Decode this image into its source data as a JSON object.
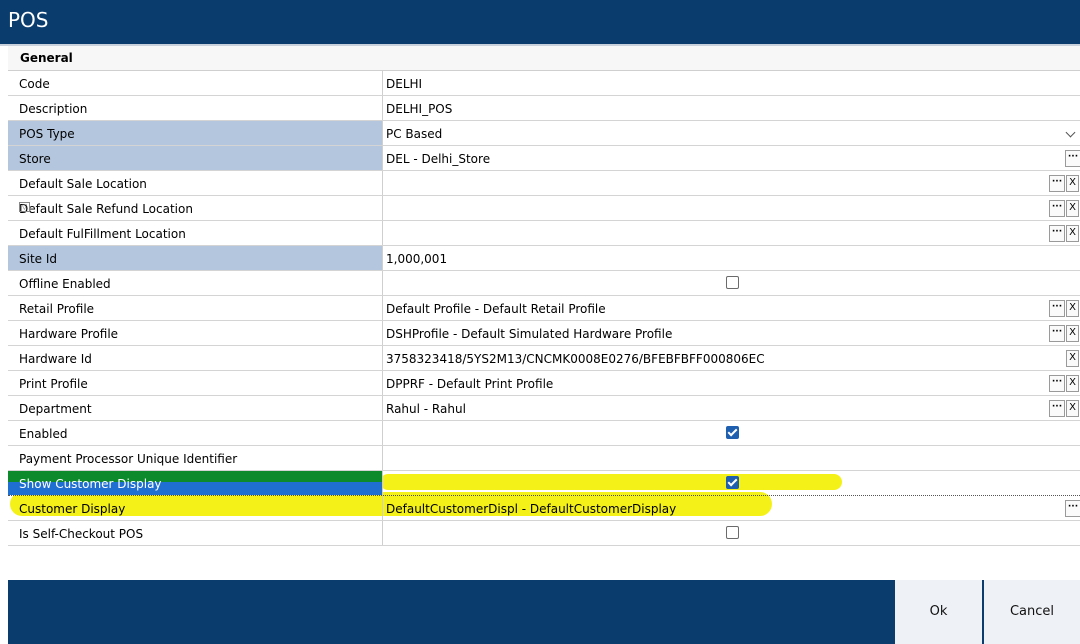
{
  "window": {
    "title": "POS"
  },
  "section": {
    "title": "General"
  },
  "fields": {
    "code": {
      "label": "Code",
      "value": "DELHI"
    },
    "description": {
      "label": "Description",
      "value": "DELHI_POS"
    },
    "pos_type": {
      "label": "POS Type",
      "value": "PC Based"
    },
    "store": {
      "label": "Store",
      "value": "DEL - Delhi_Store"
    },
    "default_sale_location": {
      "label": "Default Sale Location",
      "value": ""
    },
    "default_sale_refund_location": {
      "label": "Default Sale Refund Location",
      "value": ""
    },
    "default_fulfillment_location": {
      "label": "Default FulFillment Location",
      "value": ""
    },
    "site_id": {
      "label": "Site Id",
      "value": "1,000,001"
    },
    "offline_enabled": {
      "label": "Offline Enabled",
      "checked": false
    },
    "retail_profile": {
      "label": "Retail Profile",
      "value": "Default Profile - Default Retail Profile"
    },
    "hardware_profile": {
      "label": "Hardware Profile",
      "value": "DSHProfile - Default Simulated Hardware Profile"
    },
    "hardware_id": {
      "label": "Hardware Id",
      "value": "3758323418/5YS2M13/CNCMK0008E0276/BFEBFBFF000806EC"
    },
    "print_profile": {
      "label": "Print Profile",
      "value": "DPPRF - Default Print Profile"
    },
    "department": {
      "label": "Department",
      "value": "Rahul - Rahul"
    },
    "enabled": {
      "label": "Enabled",
      "checked": true
    },
    "payment_processor_uid": {
      "label": "Payment Processor Unique Identifier",
      "value": ""
    },
    "show_customer_display": {
      "label": "Show Customer Display",
      "checked": true
    },
    "customer_display": {
      "label": "Customer Display",
      "value": "DefaultCustomerDispl - DefaultCustomerDisplay"
    },
    "is_self_checkout_pos": {
      "label": "Is Self-Checkout POS",
      "checked": false
    }
  },
  "buttons": {
    "more": "···",
    "clear": "X",
    "filter": "▽",
    "ok": "Ok",
    "cancel": "Cancel"
  },
  "colors": {
    "header": "#0a3d6e",
    "required_label": "#b4c6de",
    "selected_row": "#1e6fd1",
    "highlight": "#f3ef00"
  }
}
